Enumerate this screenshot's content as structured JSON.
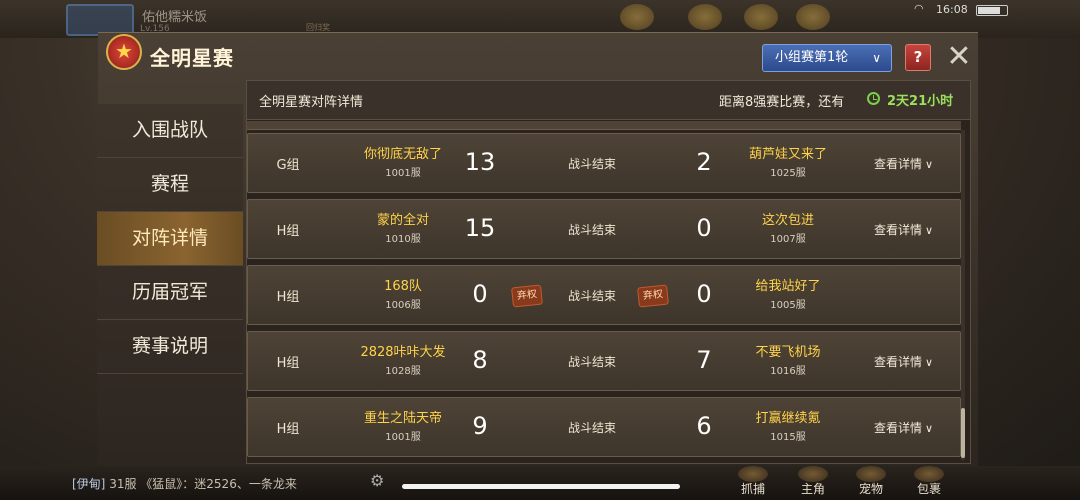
{
  "background": {
    "player_name": "佑他糯米饭",
    "player_level": "Lv.156",
    "player_badge": "回归奖",
    "status_time": "16:08",
    "wifi_icon": "wifi-icon"
  },
  "header": {
    "emblem_icon": "star-shield-icon",
    "title": "全明星赛",
    "round_select": "小组赛第1轮",
    "help_label": "?",
    "close_label": "✕"
  },
  "sidebar": {
    "items": [
      {
        "label": "入围战队",
        "active": false
      },
      {
        "label": "赛程",
        "active": false
      },
      {
        "label": "对阵详情",
        "active": true
      },
      {
        "label": "历届冠军",
        "active": false
      },
      {
        "label": "赛事说明",
        "active": false
      }
    ]
  },
  "panel": {
    "title": "全明星赛对阵详情",
    "countdown_label": "距离8强赛比赛，还有",
    "countdown_value": "2天21小时",
    "detail_label": "查看详情",
    "forfeit_label": "弃权",
    "matches": [
      {
        "group": "G组",
        "team_a": "你彻底无敌了",
        "server_a": "1001服",
        "score_a": "13",
        "status": "战斗结束",
        "score_b": "2",
        "team_b": "葫芦娃又来了",
        "server_b": "1025服",
        "forfeit_a": false,
        "forfeit_b": false,
        "has_detail": true
      },
      {
        "group": "H组",
        "team_a": "蒙的全对",
        "server_a": "1010服",
        "score_a": "15",
        "status": "战斗结束",
        "score_b": "0",
        "team_b": "这次包进",
        "server_b": "1007服",
        "forfeit_a": false,
        "forfeit_b": false,
        "has_detail": true
      },
      {
        "group": "H组",
        "team_a": "168队",
        "server_a": "1006服",
        "score_a": "0",
        "status": "战斗结束",
        "score_b": "0",
        "team_b": "给我站好了",
        "server_b": "1005服",
        "forfeit_a": true,
        "forfeit_b": true,
        "has_detail": false
      },
      {
        "group": "H组",
        "team_a": "2828咔咔大发",
        "server_a": "1028服",
        "score_a": "8",
        "status": "战斗结束",
        "score_b": "7",
        "team_b": "不要飞机场",
        "server_b": "1016服",
        "forfeit_a": false,
        "forfeit_b": false,
        "has_detail": true
      },
      {
        "group": "H组",
        "team_a": "重生之陆天帝",
        "server_a": "1001服",
        "score_a": "9",
        "status": "战斗结束",
        "score_b": "6",
        "team_b": "打赢继续氪",
        "server_b": "1015服",
        "forfeit_a": false,
        "forfeit_b": false,
        "has_detail": true
      }
    ]
  },
  "bottom": {
    "chat_channel": "[伊甸]",
    "chat_text": "31服 《猛鼠》：迷2526、一条龙来",
    "nav": [
      "抓捕",
      "主角",
      "宠物",
      "包裹"
    ]
  },
  "colors": {
    "team_name": "#ffd34a",
    "countdown": "#9be05a",
    "select_blue": "#2c4a8c",
    "help_red": "#8c2520"
  }
}
